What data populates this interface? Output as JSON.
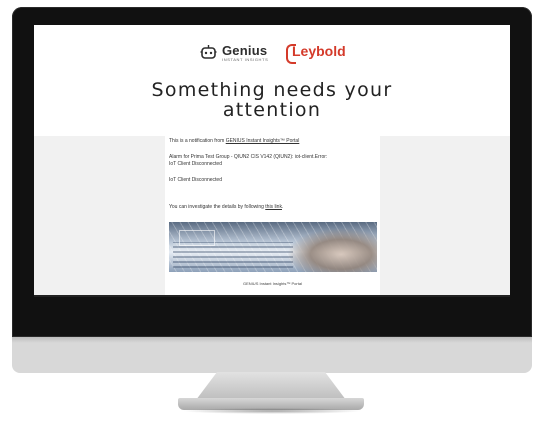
{
  "logos": {
    "genius_name": "Genius",
    "genius_tagline": "INSTANT INSIGHTS",
    "leybold_name": "Leybold"
  },
  "email": {
    "headline_line1": "Something needs your",
    "headline_line2": "attention",
    "notification_prefix": "This is a notification from ",
    "notification_link": "GENIUS Instant Insights™ Portal",
    "alarm_line1": "Alarm for Prima Test Group - QIUN2 CIS V142 (QIUN2): iot-client.Error:",
    "alarm_line2": "IoT Client Disconnected",
    "status_text": "IoT Client Disconnected",
    "investigate_prefix": "You can investigate the details by following ",
    "investigate_link": "this link",
    "investigate_suffix": ".",
    "footer": "GENIUS Instant Insights™ Portal"
  },
  "icons": {
    "genius": "robot-head-icon",
    "leybold": "bracket-logo-icon"
  },
  "colors": {
    "leybold_red": "#d43a2a",
    "band_gray": "#f1f1f1"
  }
}
